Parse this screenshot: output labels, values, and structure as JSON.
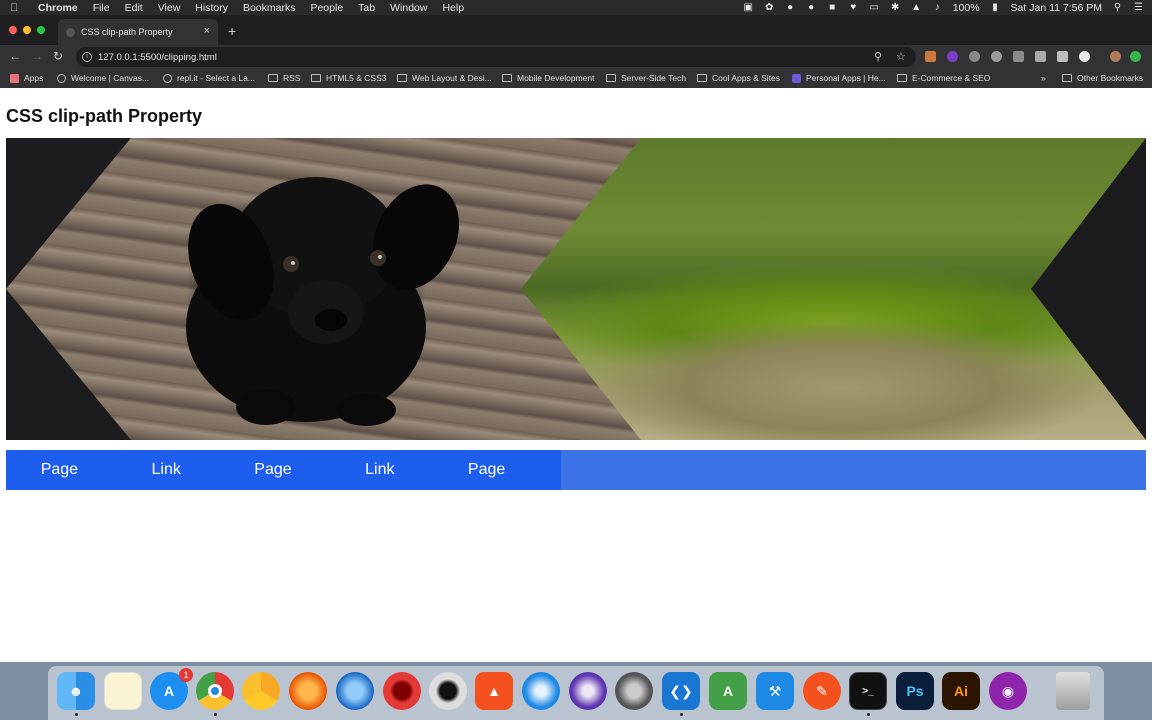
{
  "menubar": {
    "app": "Chrome",
    "items": [
      "File",
      "Edit",
      "View",
      "History",
      "Bookmarks",
      "People",
      "Tab",
      "Window",
      "Help"
    ],
    "battery": "100%",
    "clock": "Sat Jan 11  7:56 PM"
  },
  "browser": {
    "tab_title": "CSS clip-path Property",
    "url": "127.0.0.1:5500/clipping.html",
    "bookmarks": [
      "Apps",
      "Welcome | Canvas...",
      "repl.it - Select a La...",
      "RSS",
      "HTML5 & CSS3",
      "Web Layout & Desi...",
      "Mobile Development",
      "Server-Side Tech",
      "Cool Apps & Sites",
      "Personal Apps | He...",
      "E-Commerce & SEO"
    ],
    "overflow": "»",
    "other_bookmarks": "Other Bookmarks"
  },
  "page": {
    "title": "CSS clip-path Property",
    "nav_links": [
      "Page",
      "Link",
      "Page",
      "Link",
      "Page"
    ]
  },
  "dock": {
    "apps": [
      "finder",
      "notes",
      "app-store",
      "chrome",
      "chrome-canary",
      "firefox",
      "firefox-developer",
      "opera",
      "opera-gx",
      "brave",
      "safari",
      "safari-preview",
      "motion",
      "vscode",
      "android-studio",
      "xcode",
      "affinity",
      "terminal",
      "Ps",
      "Ai",
      "podcasts",
      "trash"
    ],
    "app_store_badge": "1"
  },
  "colors": {
    "nav_link_bg": "#1e5eee",
    "nav_bar_bg": "#3b73e6",
    "hero_bg": "#1c1c1e"
  }
}
